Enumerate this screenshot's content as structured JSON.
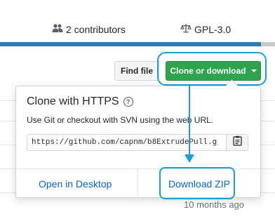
{
  "stats": {
    "contributors": "2 contributors",
    "license": "GPL-3.0"
  },
  "toolbar": {
    "find_file": "Find file",
    "clone_or_download": "Clone or download"
  },
  "clone_dropdown": {
    "title": "Clone with HTTPS",
    "description": "Use Git or checkout with SVN using the web URL.",
    "url": "https://github.com/capnm/b8ExtrudePull.g",
    "open_in_desktop": "Open in Desktop",
    "download_zip": "Download ZIP"
  },
  "file_list": {
    "timestamp": "10 months ago"
  },
  "colors": {
    "primary_button": "#2ea44f",
    "link": "#0366d6",
    "annotation": "#1aa0d8",
    "language_bar": "#2b7bb9"
  },
  "icons": [
    "people-icon",
    "law-icon",
    "help-icon",
    "clipboard-icon",
    "caret-down-icon"
  ]
}
